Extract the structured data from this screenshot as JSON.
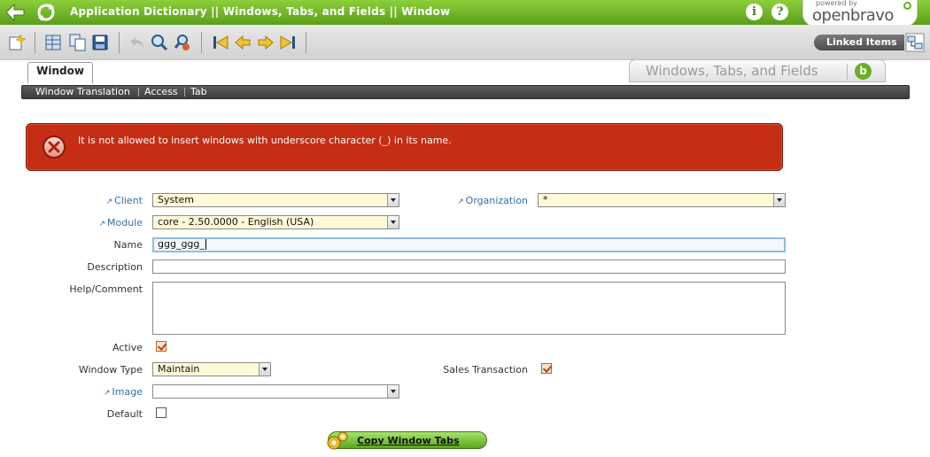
{
  "header": {
    "breadcrumb": "Application Dictionary || Windows, Tabs, and Fields  ||  Window",
    "info_glyph": "i",
    "help_glyph": "?",
    "logo_powered": "powered by",
    "logo_name": "openbravo"
  },
  "toolbar": {
    "icons": [
      "new-icon",
      "grid-icon",
      "copy-icon",
      "save-icon",
      "undo-icon",
      "search-icon",
      "advanced-search-icon",
      "first-record-icon",
      "previous-record-icon",
      "next-record-icon",
      "last-record-icon"
    ],
    "linked_items": "Linked Items"
  },
  "tabs": {
    "active": "Window",
    "title": "Windows, Tabs, and Fields",
    "subtabs": [
      "Window Translation",
      "Access",
      "Tab"
    ]
  },
  "error": {
    "message": "It is not allowed to insert windows with underscore character (_) in its name."
  },
  "form": {
    "client": {
      "label": "Client",
      "value": "System"
    },
    "organization": {
      "label": "Organization",
      "value": "*"
    },
    "module": {
      "label": "Module",
      "value": "core - 2.50.0000 - English (USA)"
    },
    "name": {
      "label": "Name",
      "value": "ggg_ggg_"
    },
    "description": {
      "label": "Description",
      "value": ""
    },
    "help": {
      "label": "Help/Comment",
      "value": ""
    },
    "active": {
      "label": "Active",
      "checked": true
    },
    "window_type": {
      "label": "Window Type",
      "value": "Maintain"
    },
    "sales_transaction": {
      "label": "Sales Transaction",
      "checked": true
    },
    "image": {
      "label": "Image",
      "value": ""
    },
    "default": {
      "label": "Default",
      "checked": false
    }
  },
  "actions": {
    "copy_window_tabs": "Copy Window Tabs"
  },
  "colors": {
    "header_green": "#6aae22",
    "error_red": "#c52d14",
    "link_blue": "#2f6fa8",
    "mandatory_yellow": "#fff9d8"
  }
}
